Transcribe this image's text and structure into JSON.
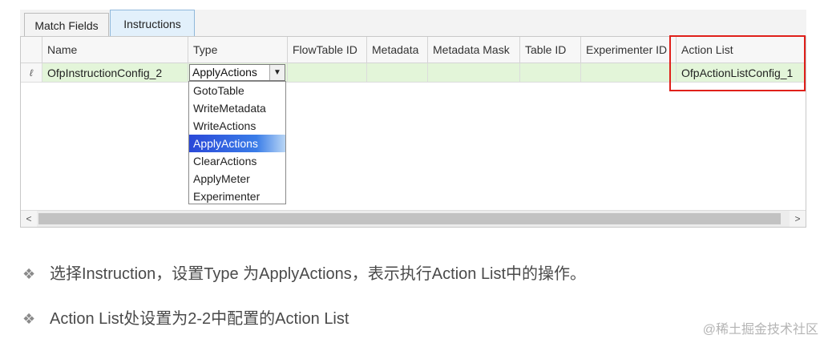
{
  "tabs": [
    {
      "label": "Match Fields"
    },
    {
      "label": "Instructions"
    }
  ],
  "grid": {
    "columns": [
      "Name",
      "Type",
      "FlowTable ID",
      "Metadata",
      "Metadata Mask",
      "Table ID",
      "Experimenter ID",
      "Action List"
    ],
    "row": {
      "indicator": "ℓ",
      "name": "OfpInstructionConfig_2",
      "type": "ApplyActions",
      "flowtable_id": "",
      "metadata": "",
      "metadata_mask": "",
      "table_id": "",
      "experimenter_id": "",
      "action_list": "OfpActionListConfig_1"
    },
    "type_dropdown_icon": "chevron-down-icon",
    "type_options": [
      "GotoTable",
      "WriteMetadata",
      "WriteActions",
      "ApplyActions",
      "ClearActions",
      "ApplyMeter",
      "Experimenter"
    ],
    "selected_option": "ApplyActions",
    "scroll_left_glyph": "<",
    "scroll_right_glyph": ">"
  },
  "notes": {
    "bullet": "❖",
    "line1": "选择Instruction，设置Type 为ApplyActions，表示执行Action List中的操作。",
    "line2": "Action List处设置为2-2中配置的Action List"
  },
  "watermark": "@稀土掘金技术社区",
  "colors": {
    "highlight": "#e0201a",
    "row_background": "#e3f5d9",
    "active_tab": "#e2f0fb",
    "selected_option": "#2a48d8"
  }
}
